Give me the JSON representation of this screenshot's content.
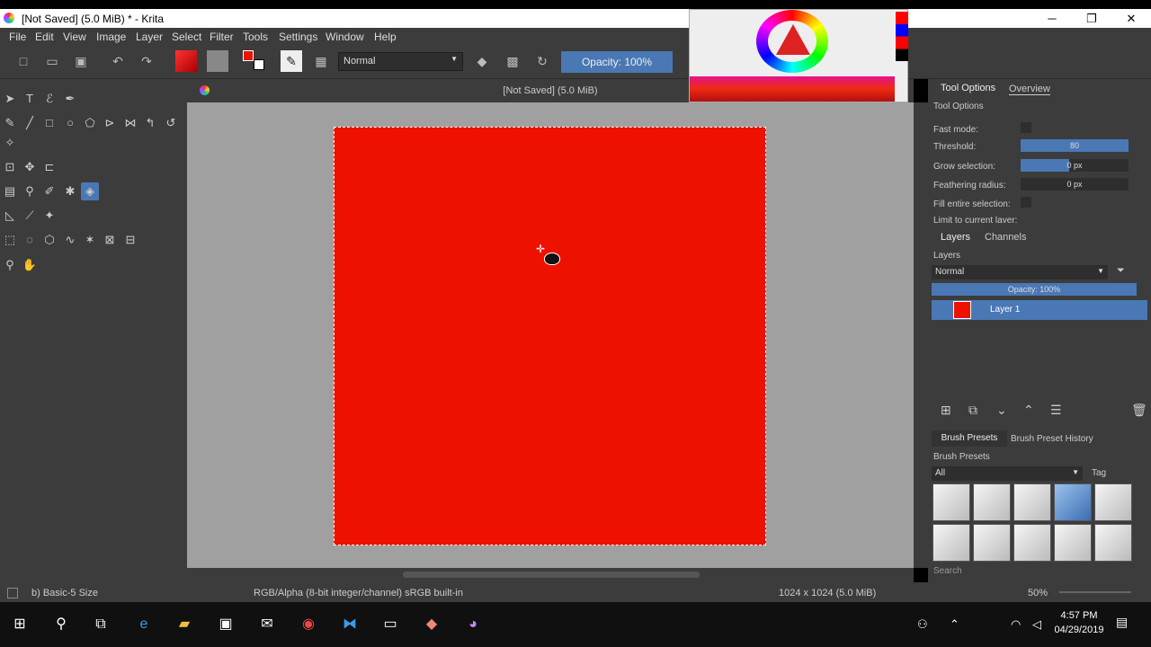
{
  "window": {
    "title": "[Not Saved]  (5.0 MiB) * - Krita"
  },
  "menu": [
    "File",
    "Edit",
    "View",
    "Image",
    "Layer",
    "Select",
    "Filter",
    "Tools",
    "Settings",
    "Window",
    "Help"
  ],
  "toolbar": {
    "blend_mode": "Normal",
    "opacity": "Opacity:  100%"
  },
  "document": {
    "tab_title": "[Not Saved]  (5.0 MiB)"
  },
  "tool_options": {
    "tabs": [
      "Tool Options",
      "Overview"
    ],
    "header": "Tool Options",
    "fast_mode": "Fast mode:",
    "threshold_label": "Threshold:",
    "threshold_value": "80",
    "grow_label": "Grow selection:",
    "grow_value": "0 px",
    "feather_label": "Feathering radius:",
    "feather_value": "0 px",
    "fill_entire": "Fill entire selection:",
    "limit_layer": "Limit to current layer:"
  },
  "layers": {
    "tabs": [
      "Layers",
      "Channels"
    ],
    "header": "Layers",
    "blend": "Normal",
    "opacity": "Opacity:  100%",
    "layer_name": "Layer 1"
  },
  "brushes": {
    "tabs": [
      "Brush Presets",
      "Brush Preset History"
    ],
    "header": "Brush Presets",
    "filter": "All",
    "tag": "Tag",
    "search": "Search"
  },
  "status": {
    "brush": "b) Basic-5 Size",
    "color_space": "RGB/Alpha (8-bit integer/channel)  sRGB built-in",
    "image_size": "1024 x 1024 (5.0 MiB)",
    "zoom": "50%"
  },
  "taskbar": {
    "time": "4:57 PM",
    "date": "04/29/2019"
  },
  "colors": {
    "foreground": "#ee1100",
    "accent": "#4a78b5"
  }
}
